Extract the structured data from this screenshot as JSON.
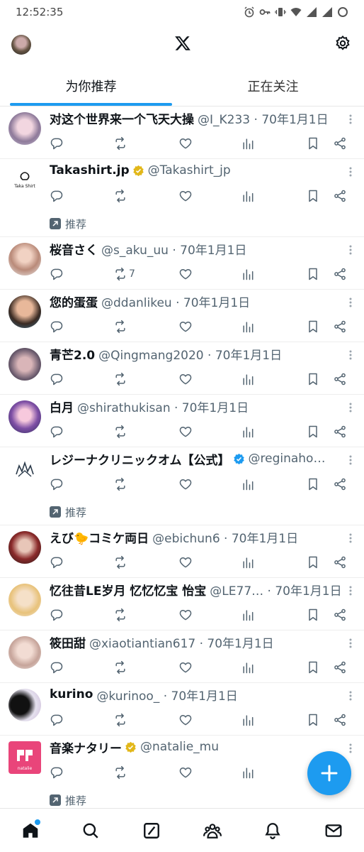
{
  "status_bar": {
    "time": "12:52:35"
  },
  "header": {
    "logo": "x-logo-icon"
  },
  "tabs": [
    {
      "label": "为你推荐",
      "active": true
    },
    {
      "label": "正在关注",
      "active": false
    }
  ],
  "promo_label": "推荐",
  "accent_color": "#1d9bf0",
  "tweets": [
    {
      "name": "对这个世界来一个飞天大操",
      "meta": "@I_K233 · 70年1月1日",
      "verified": false,
      "retweets": "",
      "promoted": false
    },
    {
      "name": "Takashirt.jp",
      "meta": "@Takashirt_jp",
      "verified": true,
      "avatar_text": "Taka Shirt",
      "retweets": "",
      "promoted": true
    },
    {
      "name": "桜音さく",
      "meta": "@s_aku_uu · 70年1月1日",
      "verified": false,
      "retweets": "7",
      "promoted": false
    },
    {
      "name": "您的蛋蛋",
      "meta": "@ddanlikeu · 70年1月1日",
      "verified": false,
      "retweets": "",
      "promoted": false
    },
    {
      "name": "青芒2.0",
      "meta": "@Qingmang2020 · 70年1月1日",
      "verified": false,
      "retweets": "",
      "promoted": false
    },
    {
      "name": "白月",
      "meta": "@shirathukisan · 70年1月1日",
      "verified": false,
      "retweets": "",
      "promoted": false
    },
    {
      "name": "レジーナクリニックオム【公式】",
      "meta": "@reginaho…",
      "verified": true,
      "retweets": "",
      "promoted": true
    },
    {
      "name": "えび🐤コミケ両日",
      "meta": "@ebichun6 · 70年1月1日",
      "verified": false,
      "retweets": "",
      "promoted": false
    },
    {
      "name": "忆往昔LE岁月 忆忆忆宝 怡宝",
      "meta": "@LE77…  · 70年1月1日",
      "verified": false,
      "retweets": "",
      "promoted": false
    },
    {
      "name": "筱田甜",
      "meta": "@xiaotiantian617 · 70年1月1日",
      "verified": false,
      "retweets": "",
      "promoted": false
    },
    {
      "name": "kurino",
      "meta": "@kurinoo_ · 70年1月1日",
      "verified": false,
      "retweets": "",
      "promoted": false
    },
    {
      "name": "音楽ナタリー",
      "meta": "@natalie_mu",
      "verified": true,
      "avatar_text": "natalie",
      "retweets": "",
      "promoted": true
    }
  ],
  "bottom_nav": [
    "home-icon",
    "search-icon",
    "grok-icon",
    "communities-icon",
    "notifications-icon",
    "messages-icon"
  ]
}
